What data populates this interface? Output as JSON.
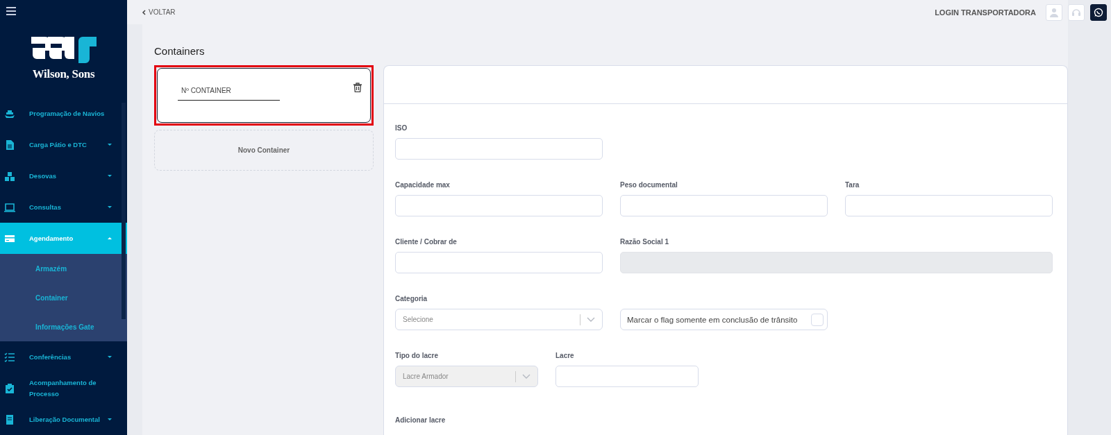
{
  "logo": {
    "text": "Wilson, Sons"
  },
  "sidebar": {
    "items": [
      {
        "label": "Programação de Navios",
        "selected": false
      },
      {
        "label": "Carga Pátio e DTC",
        "expanded": false,
        "selected": false
      },
      {
        "label": "Desovas",
        "expanded": false,
        "selected": false
      },
      {
        "label": "Consultas",
        "expanded": false,
        "selected": false
      },
      {
        "label": "Agendamento",
        "expanded": true,
        "selected": true,
        "children": [
          {
            "label": "Armazém"
          },
          {
            "label": "Container"
          },
          {
            "label": "Informações Gate"
          }
        ]
      },
      {
        "label": "Conferências",
        "expanded": false,
        "selected": false
      },
      {
        "label": "Acompanhamento de Processo",
        "selected": false
      },
      {
        "label": "Liberação Documental",
        "expanded": false,
        "selected": false
      }
    ]
  },
  "topbar": {
    "back": "VOLTAR",
    "user": "LOGIN TRANSPORTADORA"
  },
  "containers": {
    "title": "Containers",
    "items": [
      {
        "placeholder": "Nº CONTAINER",
        "highlighted": true
      }
    ],
    "add_label": "Novo Container"
  },
  "form": {
    "rows": [
      [
        {
          "kind": "text",
          "label": "ISO",
          "disabled": false
        }
      ],
      [
        {
          "kind": "text",
          "label": "Capacidade max",
          "disabled": false
        },
        {
          "kind": "text",
          "label": "Peso documental",
          "disabled": false
        },
        {
          "kind": "text",
          "label": "Tara",
          "disabled": false
        }
      ],
      [
        {
          "kind": "text",
          "label": "Cliente / Cobrar de",
          "disabled": false
        },
        {
          "kind": "text",
          "label": "Razão Social 1",
          "disabled": true
        }
      ],
      [
        {
          "kind": "select",
          "label": "Categoria",
          "placeholder": "Selecione",
          "disabled": false
        },
        {
          "kind": "checkbox",
          "text": "Marcar o flag somente em conclusão de trânsito",
          "checked": false
        }
      ],
      [
        {
          "kind": "select",
          "label": "Tipo do lacre",
          "value": "Lacre Armador",
          "disabled": true
        },
        {
          "kind": "text",
          "label": "Lacre",
          "disabled": false
        }
      ]
    ],
    "section": "Adicionar lacre"
  }
}
